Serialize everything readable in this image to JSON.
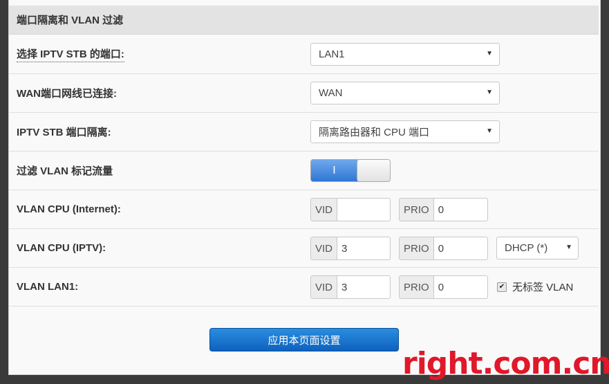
{
  "section_title": "端口隔离和 VLAN 过滤",
  "rows": {
    "iptv_port": {
      "label": "选择 IPTV STB 的端口:",
      "value": "LAN1"
    },
    "wan_port": {
      "label": "WAN端口网线已连接:",
      "value": "WAN"
    },
    "isolation": {
      "label": "IPTV STB 端口隔离:",
      "value": "隔离路由器和 CPU 端口"
    },
    "vlan_filter": {
      "label": "过滤 VLAN 标记流量",
      "toggle_on_text": "I",
      "enabled": true
    },
    "vlan_cpu_internet": {
      "label": "VLAN CPU (Internet):",
      "vid_label": "VID",
      "vid": "",
      "prio_label": "PRIO",
      "prio": "0"
    },
    "vlan_cpu_iptv": {
      "label": "VLAN CPU (IPTV):",
      "vid_label": "VID",
      "vid": "3",
      "prio_label": "PRIO",
      "prio": "0",
      "mode": "DHCP (*)"
    },
    "vlan_lan1": {
      "label": "VLAN LAN1:",
      "vid_label": "VID",
      "vid": "3",
      "prio_label": "PRIO",
      "prio": "0",
      "untagged_label": "无标签 VLAN",
      "untagged_checked": true
    }
  },
  "apply_button": "应用本页面设置",
  "watermark": "right.com.cn",
  "icons": {
    "dropdown": "chevron-down-icon",
    "check": "checkmark-icon"
  },
  "colors": {
    "accent": "#1a73d0",
    "watermark": "#e0182a"
  }
}
